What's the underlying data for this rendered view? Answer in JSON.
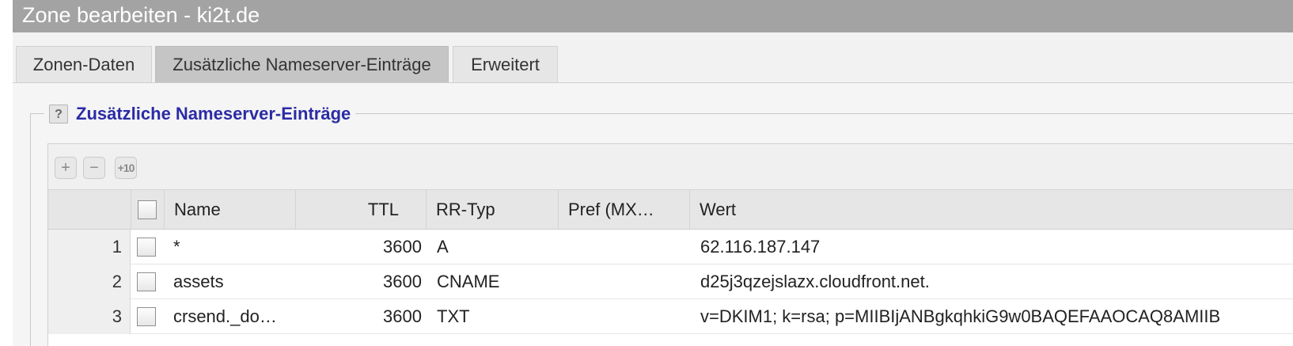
{
  "window": {
    "title": "Zone bearbeiten - ki2t.de"
  },
  "tabs": [
    {
      "label": "Zonen-Daten",
      "active": false
    },
    {
      "label": "Zusätzliche Nameserver-Einträge",
      "active": true
    },
    {
      "label": "Erweitert",
      "active": false
    }
  ],
  "section": {
    "title": "Zusätzliche Nameserver-Einträge",
    "help_icon": "question-icon"
  },
  "toolbar": {
    "add_label": "+",
    "remove_label": "−",
    "add10_label": "+10"
  },
  "table": {
    "columns": [
      "Name",
      "TTL",
      "RR-Typ",
      "Pref (MX…",
      "Wert"
    ],
    "rows": [
      {
        "num": "1",
        "name": "*",
        "ttl": "3600",
        "type": "A",
        "pref": "",
        "value": "62.116.187.147"
      },
      {
        "num": "2",
        "name": "assets",
        "ttl": "3600",
        "type": "CNAME",
        "pref": "",
        "value": "d25j3qzejslazx.cloudfront.net."
      },
      {
        "num": "3",
        "name": "crsend._do…",
        "ttl": "3600",
        "type": "TXT",
        "pref": "",
        "value": "v=DKIM1; k=rsa; p=MIIBIjANBgkqhkiG9w0BAQEFAAOCAQ8AMIIB"
      }
    ]
  },
  "colors": {
    "titlebar": "#a3a3a3",
    "section_title": "#2b2ba6",
    "active_tab": "#c5c5c5"
  }
}
